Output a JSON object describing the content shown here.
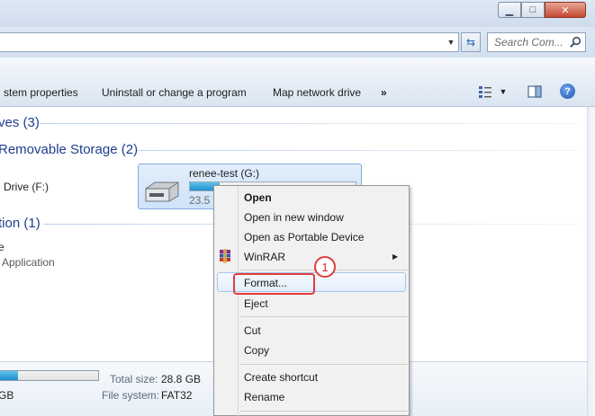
{
  "search": {
    "placeholder": "Search Com..."
  },
  "toolbar": {
    "system_properties": "stem properties",
    "uninstall": "Uninstall or change a program",
    "map_drive": "Map network drive",
    "more": "»"
  },
  "groups": {
    "drives": "ves (3)",
    "removable": "Removable Storage (2)",
    "other": "tion (1)"
  },
  "items": {
    "drive_f": "Drive (F:)",
    "e_item": "e",
    "application": "Application"
  },
  "selected_drive": {
    "name": "renee-test (G:)",
    "free_partial": "23.5 (",
    "used_fraction": 0.18
  },
  "details": {
    "used_fraction": 0.18,
    "size_tail": "GB",
    "total_label": "Total size:",
    "total_value": "28.8 GB",
    "fs_label": "File system:",
    "fs_value": "FAT32"
  },
  "context_menu": {
    "open": "Open",
    "open_new_window": "Open in new window",
    "open_portable": "Open as Portable Device",
    "winrar": "WinRAR",
    "format": "Format...",
    "eject": "Eject",
    "cut": "Cut",
    "copy": "Copy",
    "create_shortcut": "Create shortcut",
    "rename": "Rename"
  },
  "annotation": {
    "step": "1"
  },
  "colors": {
    "highlight_red": "#e23c3c",
    "accent_blue": "#1e3d8f"
  }
}
